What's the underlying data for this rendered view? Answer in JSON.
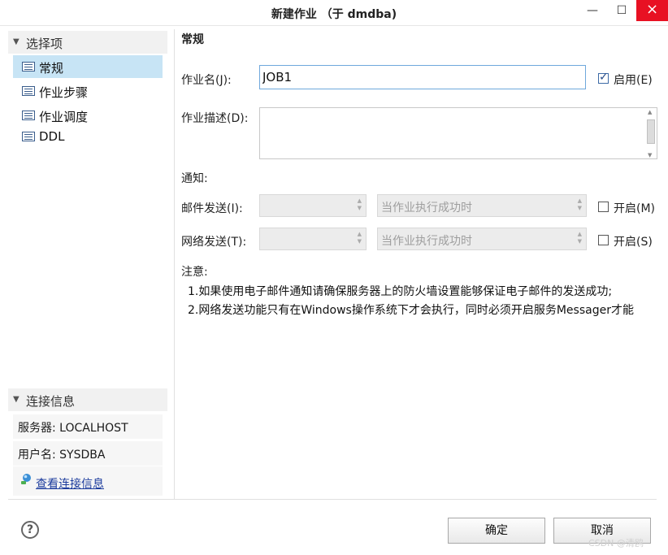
{
  "window": {
    "title": "新建作业 （于 dmdba)",
    "min_icon": "minimize-icon",
    "max_icon": "maximize-icon",
    "close_icon": "close-icon"
  },
  "sidebar": {
    "options_header": "选择项",
    "items": [
      {
        "label": "常规",
        "selected": true,
        "icon": "list-icon"
      },
      {
        "label": "作业步骤",
        "selected": false,
        "icon": "list-icon"
      },
      {
        "label": "作业调度",
        "selected": false,
        "icon": "list-icon"
      },
      {
        "label": "DDL",
        "selected": false,
        "icon": "list-icon"
      }
    ],
    "connection_header": "连接信息",
    "server": "服务器: LOCALHOST",
    "user": "用户名: SYSDBA",
    "view_link": "查看连接信息"
  },
  "general": {
    "section_title": "常规",
    "job_name_label": "作业名(J):",
    "job_name_value": "JOB1",
    "enable_label": "启用(E)",
    "enable_checked": true,
    "desc_label": "作业描述(D):",
    "desc_value": "",
    "notify_label": "通知:",
    "mail_label": "邮件发送(I):",
    "mail_operator": "",
    "mail_condition": "当作业执行成功时",
    "mail_open_label": "开启(M)",
    "mail_open_checked": false,
    "net_label": "网络发送(T):",
    "net_operator": "",
    "net_condition": "当作业执行成功时",
    "net_open_label": "开启(S)",
    "net_open_checked": false,
    "note_title": "注意:",
    "note_1": "1.如果使用电子邮件通知请确保服务器上的防火墙设置能够保证电子邮件的发送成功;",
    "note_2": "2.网络发送功能只有在Windows操作系统下才会执行，同时必须开启服务Messager才能"
  },
  "footer": {
    "help_icon": "help-icon",
    "help_glyph": "?",
    "ok_label": "确定",
    "cancel_label": "取消",
    "watermark": "CSDN @清鸥"
  },
  "colors": {
    "selected_bg": "#c7e4f5",
    "close_bg": "#e81123",
    "link": "#1a3a9c"
  }
}
